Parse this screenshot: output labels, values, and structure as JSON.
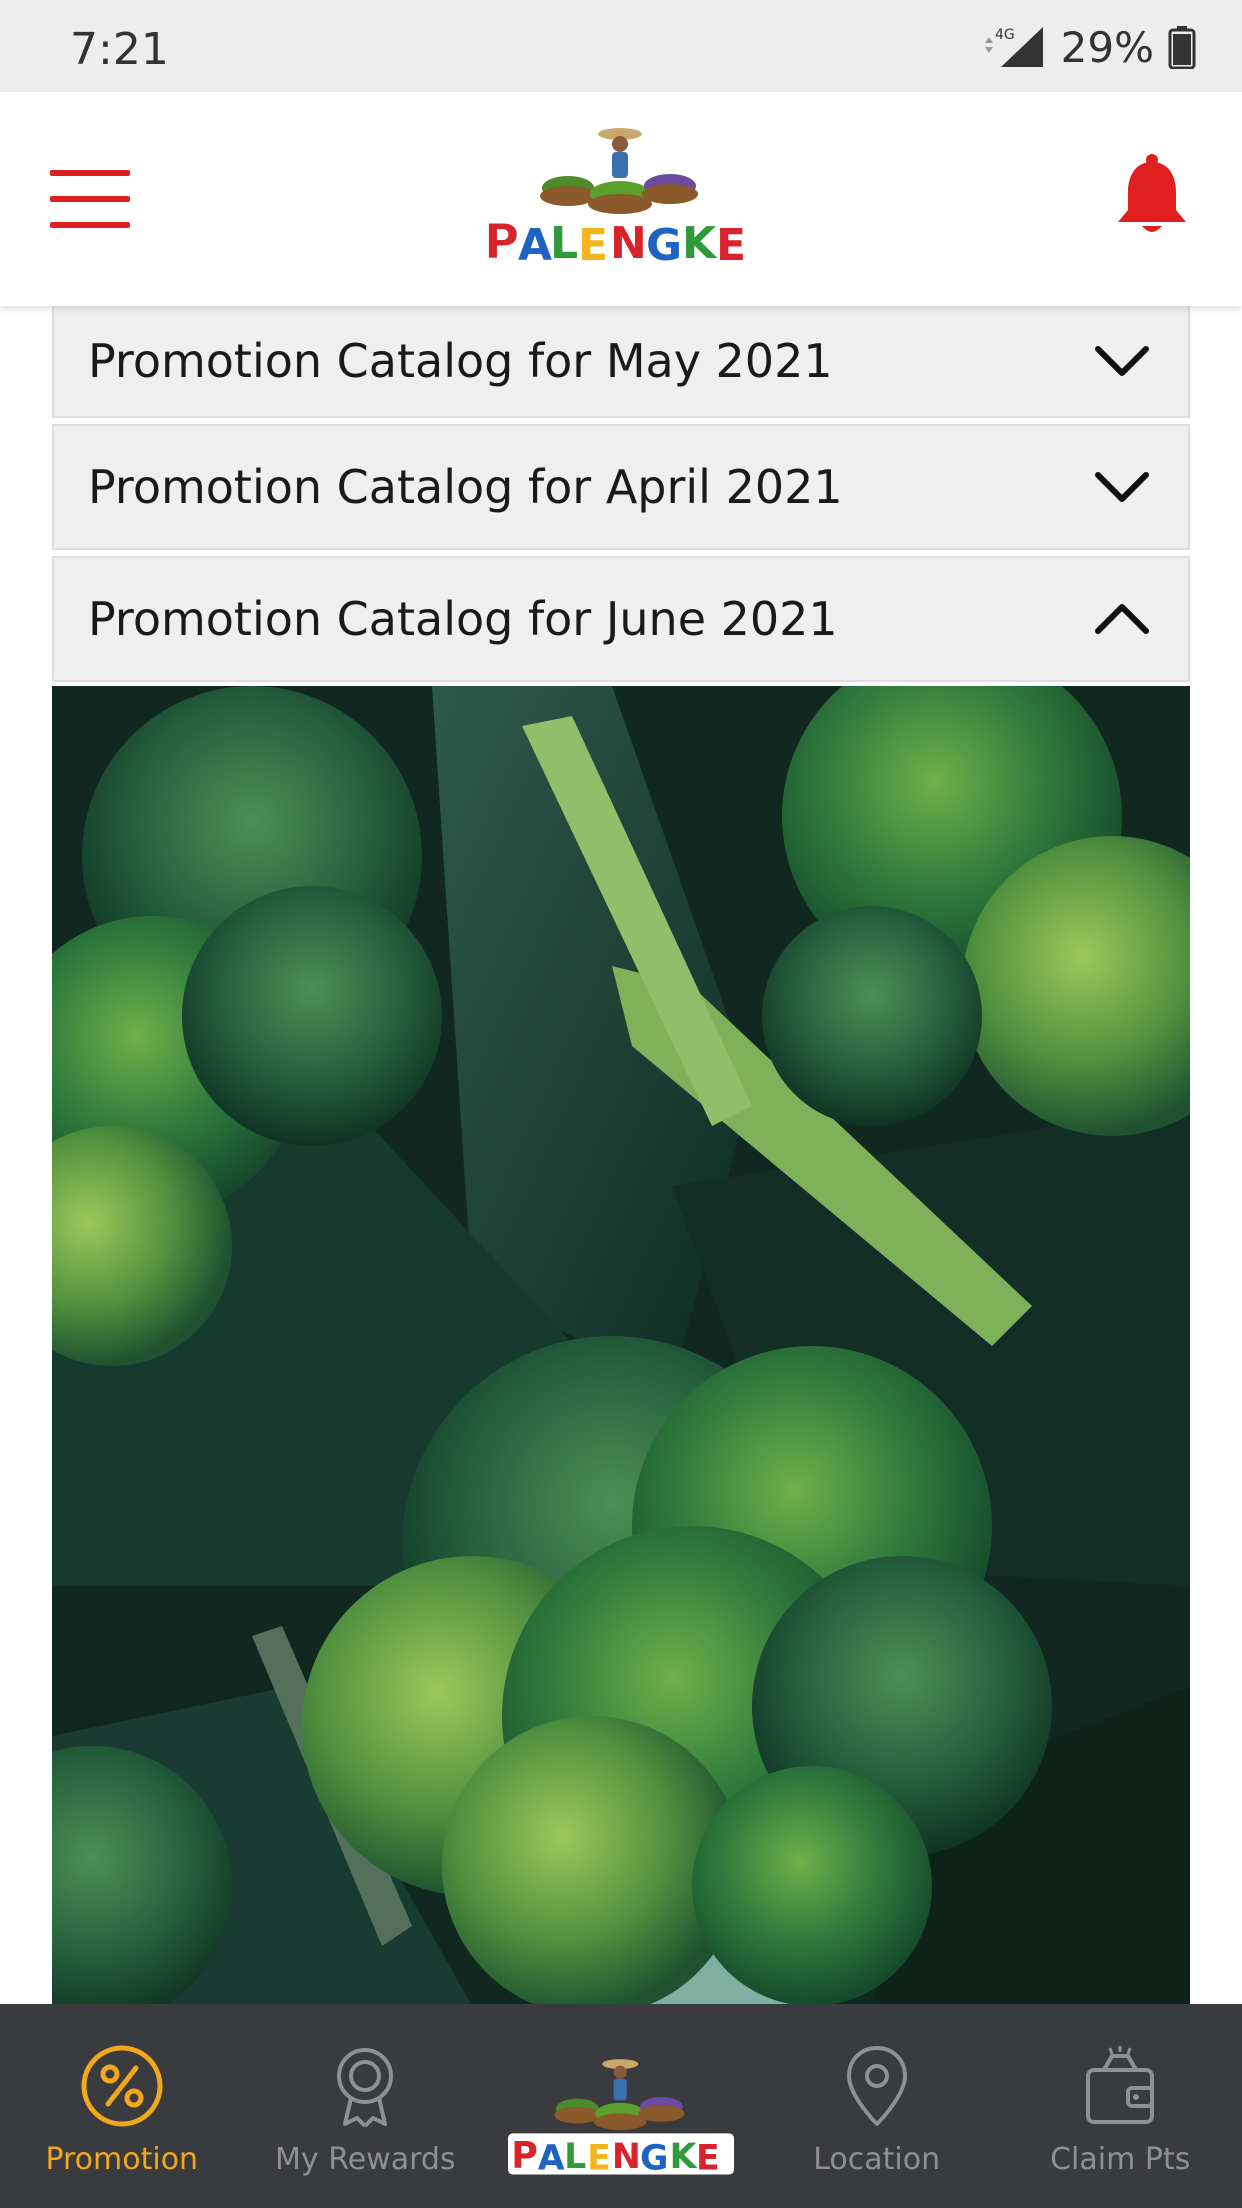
{
  "status_bar": {
    "time": "7:21",
    "network": "4G",
    "battery": "29%"
  },
  "header": {
    "logo_text": "PALENGKE",
    "menu_icon": "hamburger-menu-icon",
    "bell_icon": "bell-icon"
  },
  "accordion": {
    "items": [
      {
        "label": "Promotion Catalog for May 2021",
        "expanded": false
      },
      {
        "label": "Promotion Catalog for April 2021",
        "expanded": false
      },
      {
        "label": "Promotion Catalog for June 2021",
        "expanded": true
      }
    ]
  },
  "catalog_image": {
    "icon": "broccoli-photo"
  },
  "bottom_nav": {
    "items": [
      {
        "label": "Promotion",
        "icon": "percent-icon",
        "active": true
      },
      {
        "label": "My Rewards",
        "icon": "award-icon",
        "active": false
      },
      {
        "label": "",
        "icon": "palengke-logo",
        "active": false
      },
      {
        "label": "Location",
        "icon": "location-pin-icon",
        "active": false
      },
      {
        "label": "Claim Pts",
        "icon": "wallet-icon",
        "active": false
      }
    ]
  },
  "colors": {
    "brand_red": "#e02020",
    "active_orange": "#f2a81d",
    "nav_bg": "#3a3b3e",
    "inactive_gray": "#8f9094"
  }
}
